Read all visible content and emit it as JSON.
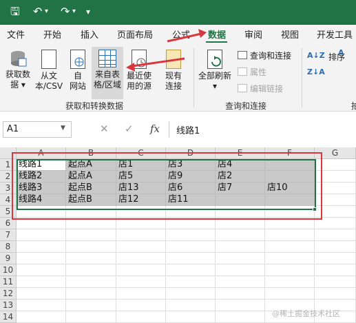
{
  "quick_access": {
    "save_icon": "save-icon",
    "undo_icon": "undo-icon",
    "redo_icon": "redo-icon"
  },
  "ribbon_tabs": [
    "文件",
    "开始",
    "插入",
    "页面布局",
    "公式",
    "数据",
    "审阅",
    "视图",
    "开发工具"
  ],
  "active_tab": "数据",
  "ribbon": {
    "get_transform": {
      "group_label": "获取和转换数据",
      "buttons": [
        {
          "line1": "获取数",
          "line2": "据 ▾"
        },
        {
          "line1": "从文",
          "line2": "本/CSV"
        },
        {
          "line1": "自",
          "line2": "网站"
        },
        {
          "line1": "来自表",
          "line2": "格/区域"
        },
        {
          "line1": "最近使",
          "line2": "用的源"
        },
        {
          "line1": "现有",
          "line2": "连接"
        }
      ]
    },
    "queries": {
      "group_label": "查询和连接",
      "refresh_line1": "全部刷新",
      "refresh_arrow": "▾",
      "items": [
        "查询和连接",
        "属性",
        "编辑链接"
      ]
    },
    "sort": {
      "label": "排序"
    },
    "partial_group_label": "拍"
  },
  "formula_bar": {
    "name_box": "A1",
    "cancel_symbol": "✕",
    "enter_symbol": "✓",
    "fx_symbol": "fx",
    "content": "线路1"
  },
  "sheet": {
    "columns": [
      "A",
      "B",
      "C",
      "D",
      "E",
      "F",
      "G"
    ],
    "rows": [
      "1",
      "2",
      "3",
      "4",
      "5",
      "6",
      "7",
      "8",
      "9",
      "10",
      "11",
      "12",
      "13",
      "14"
    ],
    "cells": [
      [
        "线路1",
        "起点A",
        "店1",
        "店3",
        "店4",
        ""
      ],
      [
        "线路2",
        "起点A",
        "店5",
        "店9",
        "店2",
        ""
      ],
      [
        "线路3",
        "起点B",
        "店13",
        "店6",
        "店7",
        "店10"
      ],
      [
        "线路4",
        "起点B",
        "店12",
        "店11",
        "",
        ""
      ]
    ]
  },
  "watermark": "@稀土掘金技术社区",
  "colors": {
    "accent": "#217346",
    "annotation": "#d9363e",
    "selection": "#c9c9c9"
  }
}
